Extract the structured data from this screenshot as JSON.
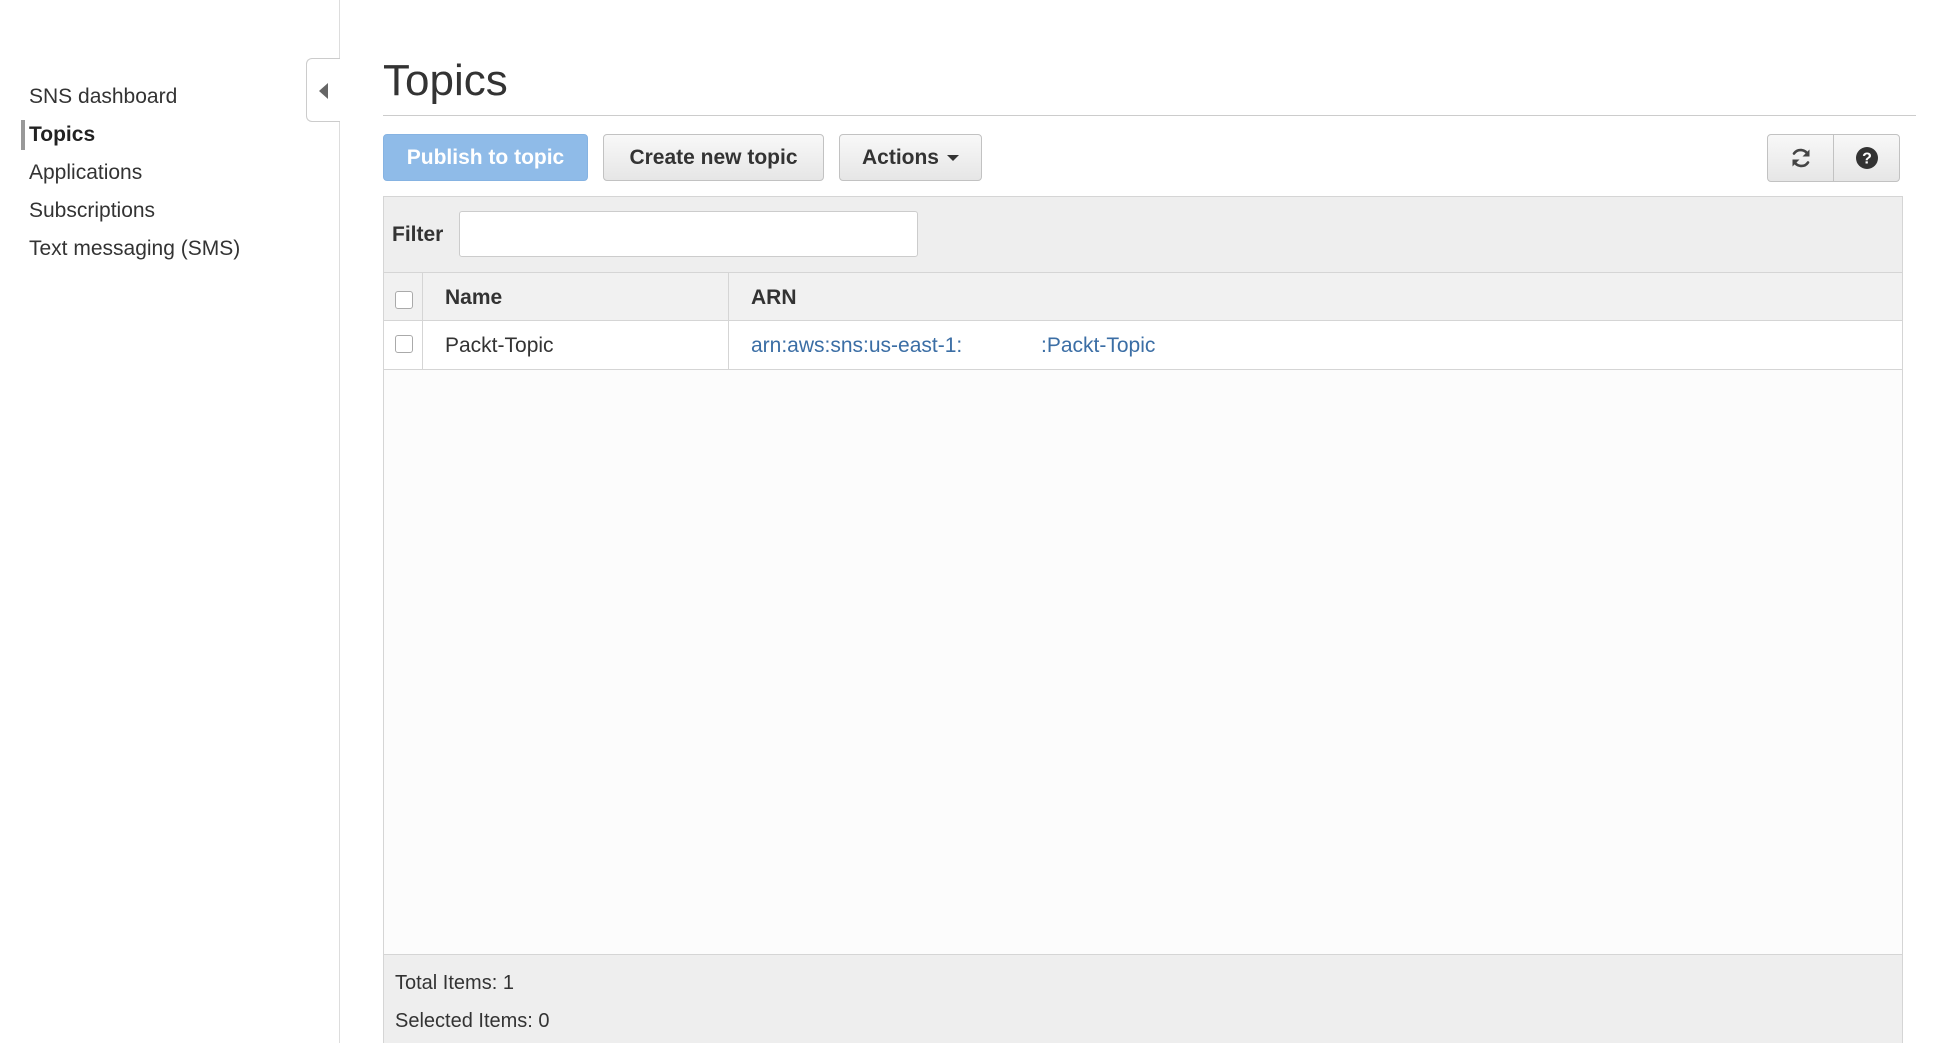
{
  "sidebar": {
    "items": [
      {
        "label": "SNS dashboard",
        "active": false
      },
      {
        "label": "Topics",
        "active": true
      },
      {
        "label": "Applications",
        "active": false
      },
      {
        "label": "Subscriptions",
        "active": false
      },
      {
        "label": "Text messaging (SMS)",
        "active": false
      }
    ]
  },
  "page": {
    "title": "Topics"
  },
  "toolbar": {
    "publish_label": "Publish to topic",
    "create_label": "Create new topic",
    "actions_label": "Actions",
    "refresh_icon": "refresh-icon",
    "help_icon": "help-icon"
  },
  "filter": {
    "label": "Filter",
    "value": "",
    "placeholder": ""
  },
  "table": {
    "columns": [
      "Name",
      "ARN"
    ],
    "rows": [
      {
        "name": "Packt-Topic",
        "arn_prefix": "arn:aws:sns:us-east-1:",
        "arn_suffix": ":Packt-Topic"
      }
    ]
  },
  "footer": {
    "total_items": "Total Items: 1",
    "selected_items": "Selected Items: 0"
  },
  "colors": {
    "primary_button": "#8fbbe8",
    "link": "#3b6ea5",
    "panel_header": "#eeeeee"
  }
}
